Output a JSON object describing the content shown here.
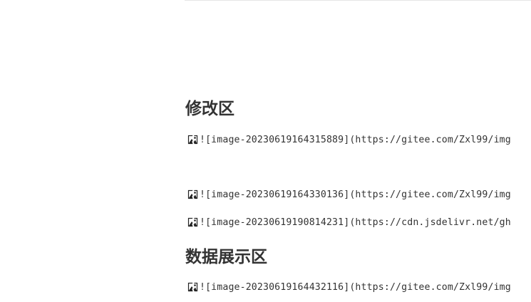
{
  "sections": [
    {
      "heading": "修改区",
      "images": [
        "![image-20230619164315889](https://gitee.com/Zxl99/img",
        "![image-20230619164330136](https://gitee.com/Zxl99/img",
        "![image-20230619190814231](https://cdn.jsdelivr.net/gh"
      ]
    },
    {
      "heading": "数据展示区",
      "images": [
        "![image-20230619164432116](https://gitee.com/Zxl99/img"
      ]
    }
  ],
  "icons": {
    "broken_image": "broken-image-icon"
  }
}
